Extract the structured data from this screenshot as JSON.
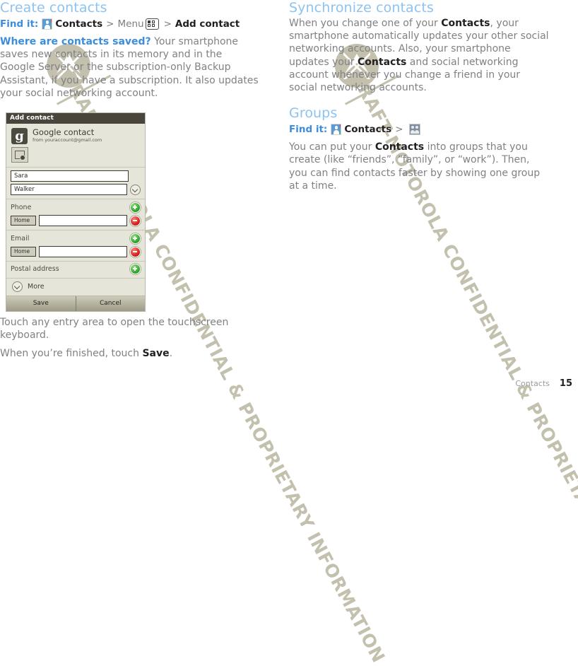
{
  "watermark": {
    "text": "DRAFT-MOTOROLA CONFIDENTIAL & PROPRIETARY INFORMATION",
    "color": "#c3c0ad",
    "logo_icon": "motorola-batwing-logo"
  },
  "left_column": {
    "heading": "Create contacts",
    "heading_color": "#8cc3f2",
    "find_it": {
      "label": "Find it:",
      "contacts_icon": "contacts-app-icon",
      "contacts": "Contacts",
      "sep1": ">",
      "menu": "Menu",
      "menu_icon": "menu-grid-icon",
      "sep2": ">",
      "add_contact": "Add contact"
    },
    "paragraph_lead": "Where are contacts saved?",
    "paragraph_body": " Your smartphone saves new contacts in its memory and in the Google Server or the subscription-only Backup Assistant, if you have a subscription. It also updates your social networking account.",
    "after_lines": [
      "Touch any entry area to open the touchscreen keyboard.",
      "When you’re finished, touch "
    ],
    "after_bold": "Save",
    "after_tail": "."
  },
  "right_column": {
    "sync": {
      "heading": "Synchronize contacts",
      "p1_a": "When you change one of your ",
      "p1_b": "Contacts",
      "p1_c": ", your smartphone automatically updates your other social networking accounts. Also, your smartphone updates your ",
      "p1_d": "Contacts",
      "p1_e": " and social networking account whenever you change a friend in your social networking accounts."
    },
    "groups": {
      "heading": "Groups",
      "find_it": {
        "label": "Find it:",
        "contacts_icon": "contacts-app-icon",
        "contacts": "Contacts",
        "sep1": ">",
        "groups_icon": "groups-people-icon"
      },
      "p1_a": "You can put your ",
      "p1_b": "Contacts",
      "p1_c": " into groups that you create (like “friends”, “family”, or “work”). Then, you can find contacts faster by showing one group at a time."
    }
  },
  "phone": {
    "title": "Add contact",
    "account": {
      "badge": "g",
      "name": "Google contact",
      "email": "from youraccount@gmail.com"
    },
    "photo_button_icon": "add-photo-icon",
    "first_name": "Sara",
    "last_name": "Walker",
    "expand_icon": "chevron-down-circle-icon",
    "phone_section": {
      "label": "Phone",
      "add_icon": "plus-circle-icon",
      "remove_icon": "minus-circle-icon",
      "type": "Home",
      "value": ""
    },
    "email_section": {
      "label": "Email",
      "add_icon": "plus-circle-icon",
      "remove_icon": "minus-circle-icon",
      "type": "Home",
      "value": ""
    },
    "postal_section": {
      "label": "Postal address",
      "add_icon": "plus-circle-icon"
    },
    "more": {
      "icon": "chevron-down-circle-icon",
      "label": "More"
    },
    "buttons": {
      "save": "Save",
      "cancel": "Cancel"
    }
  },
  "footer": {
    "section": "Contacts",
    "page": "15"
  }
}
